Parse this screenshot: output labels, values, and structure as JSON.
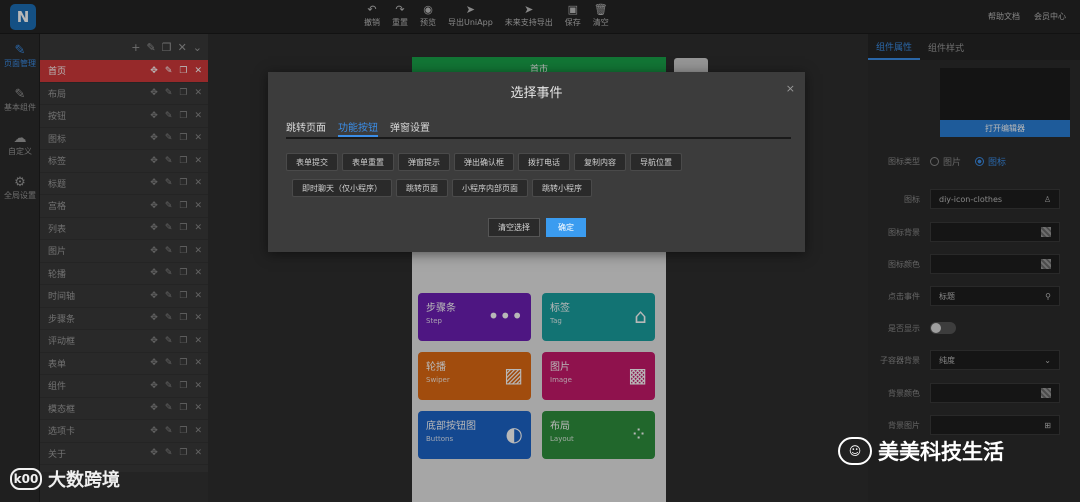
{
  "app": {
    "logo_text": "N"
  },
  "toolbar": [
    {
      "icon": "undo-icon",
      "glyph": "↶",
      "label": "撤销"
    },
    {
      "icon": "redo-icon",
      "glyph": "↷",
      "label": "重置"
    },
    {
      "icon": "eye-icon",
      "glyph": "◉",
      "label": "预览"
    },
    {
      "icon": "send-icon",
      "glyph": "➤",
      "label": "导出UniApp"
    },
    {
      "icon": "send-icon",
      "glyph": "➤",
      "label": "未来支持导出"
    },
    {
      "icon": "save-icon",
      "glyph": "▣",
      "label": "保存"
    },
    {
      "icon": "trash-icon",
      "glyph": "🗑",
      "label": "清空"
    }
  ],
  "top_links": [
    "帮助文档",
    "会员中心"
  ],
  "leftnav": [
    {
      "icon": "page-icon",
      "glyph": "✎",
      "label": "页面管理",
      "active": true
    },
    {
      "icon": "component-icon",
      "glyph": "✎",
      "label": "基本组件"
    },
    {
      "icon": "cloud-icon",
      "glyph": "☁",
      "label": "自定义"
    },
    {
      "icon": "gear-icon",
      "glyph": "⚙",
      "label": "全局设置"
    }
  ],
  "components": [
    "首页",
    "布局",
    "按钮",
    "图标",
    "标签",
    "标题",
    "宫格",
    "列表",
    "图片",
    "轮播",
    "时间轴",
    "步骤条",
    "评动框",
    "表单",
    "组件",
    "模态框",
    "选项卡",
    "关于"
  ],
  "canvas": {
    "header": "首市",
    "tiles": [
      {
        "title": "步骤条",
        "sub": "Step",
        "glyph": "•••",
        "color": "#6d1fb5"
      },
      {
        "title": "标签",
        "sub": "Tag",
        "glyph": "⌂",
        "color": "#1aa0a0"
      },
      {
        "title": "轮播",
        "sub": "Swiper",
        "glyph": "▨",
        "color": "#e06a12"
      },
      {
        "title": "图片",
        "sub": "Image",
        "glyph": "▩",
        "color": "#c7196b"
      },
      {
        "title": "底部按钮图",
        "sub": "Buttons",
        "glyph": "◐",
        "color": "#1d64c8"
      },
      {
        "title": "布局",
        "sub": "Layout",
        "glyph": "⁘",
        "color": "#2e8f3d"
      }
    ]
  },
  "right": {
    "tabs": [
      "组件属性",
      "组件样式"
    ],
    "open_editor": "打开编辑器",
    "icon_type_label": "图标类型",
    "icon_type_options": [
      "图片",
      "图标"
    ],
    "icon_label": "图标",
    "icon_value": "diy-icon-clothes",
    "icon_bg_label": "图标背景",
    "icon_color_label": "图标颜色",
    "click_event_label": "点击事件",
    "click_event_value": "标题",
    "show_label": "是否显示",
    "sub_align_label": "子容器背景",
    "sub_align_value": "纯度",
    "bg_color_label": "背景颜色",
    "bg_image_label": "背景图片"
  },
  "modal": {
    "title": "选择事件",
    "close": "×",
    "tabs": [
      "跳转页面",
      "功能按钮",
      "弹窗设置"
    ],
    "active_tab": 1,
    "events_row1": [
      "表单提交",
      "表单重置",
      "弹窗提示",
      "弹出确认框",
      "拨打电话",
      "复制内容",
      "导航位置"
    ],
    "events_row2": [
      "即时聊天（仅小程序）",
      "跳转页面",
      "小程序内部页面",
      "跳转小程序"
    ],
    "clear": "清空选择",
    "ok": "确定"
  },
  "watermarks": {
    "left_logo": "k00",
    "left": "大数跨境",
    "right_logo": "☺",
    "right": "美美科技生活"
  }
}
